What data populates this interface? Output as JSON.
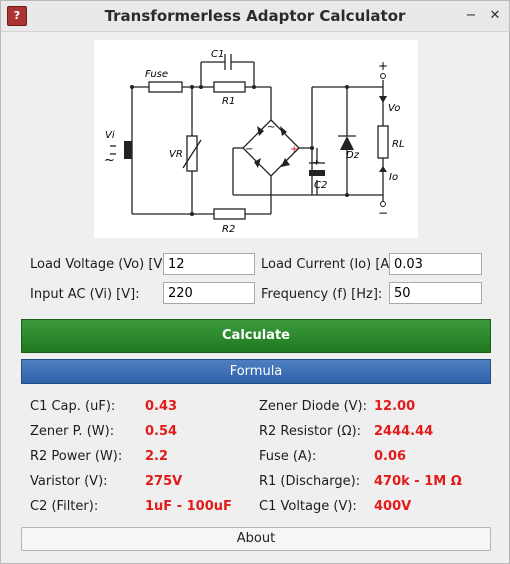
{
  "window": {
    "title": "Transformerless Adaptor Calculator",
    "minimize_glyph": "−",
    "maximize_glyph": "□",
    "close_glyph": "✕"
  },
  "diagram": {
    "labels": {
      "c1": "C1",
      "fuse": "Fuse",
      "r1": "R1",
      "vi": "Vi",
      "vr": "VR",
      "r2": "R2",
      "c2": "C2",
      "dz": "Dz",
      "rl": "RL",
      "vo": "Vo",
      "io": "Io",
      "plus": "+",
      "minus": "−",
      "tilde": "~",
      "bridge_minus": "−",
      "bridge_plus": "+",
      "c2_plus": "+"
    }
  },
  "inputs": {
    "load_voltage": {
      "label": "Load Voltage (Vo) [V]:",
      "value": "12"
    },
    "load_current": {
      "label": "Load Current (Io) [A]:",
      "value": "0.03"
    },
    "input_ac": {
      "label": "Input AC (Vi) [V]:",
      "value": "220"
    },
    "frequency": {
      "label": "Frequency (f) [Hz]:",
      "value": "50"
    }
  },
  "buttons": {
    "calculate": "Calculate",
    "formula": "Formula",
    "about": "About"
  },
  "results": {
    "c1_cap": {
      "label": "C1 Cap. (uF):",
      "value": "0.43"
    },
    "zener_diode": {
      "label": "Zener Diode (V):",
      "value": "12.00"
    },
    "zener_power": {
      "label": "Zener P. (W):",
      "value": "0.54"
    },
    "r2_resistor": {
      "label": "R2 Resistor (Ω):",
      "value": "2444.44"
    },
    "r2_power": {
      "label": "R2 Power (W):",
      "value": "2.2"
    },
    "fuse": {
      "label": "Fuse (A):",
      "value": "0.06"
    },
    "varistor": {
      "label": "Varistor (V):",
      "value": "275V"
    },
    "r1_discharge": {
      "label": "R1 (Discharge):",
      "value": "470k - 1M Ω"
    },
    "c2_filter": {
      "label": "C2 (Filter):",
      "value": "1uF - 100uF"
    },
    "c1_voltage": {
      "label": "C1 Voltage (V):",
      "value": "400V"
    }
  },
  "colors": {
    "result_value": "#e21b1b",
    "calculate_button": "#2e8b2e",
    "formula_button": "#3b6fb6"
  }
}
